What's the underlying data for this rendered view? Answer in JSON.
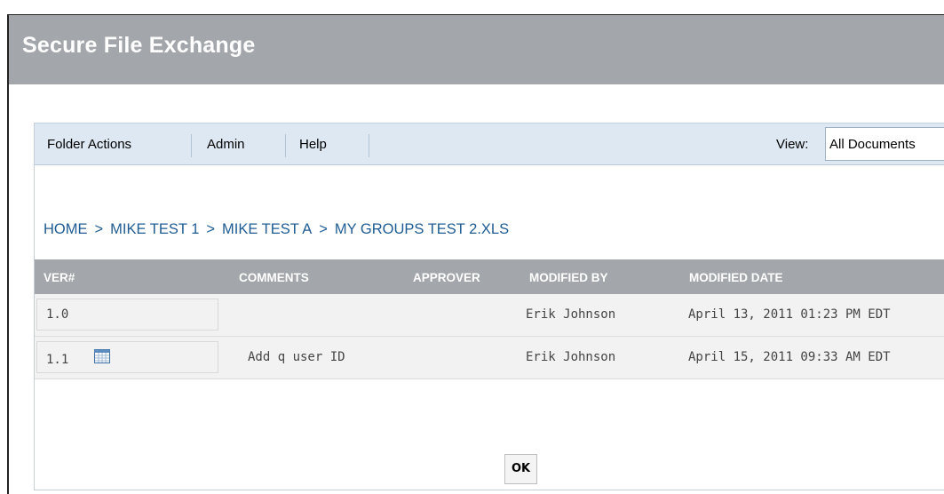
{
  "app": {
    "title": "Secure File Exchange"
  },
  "toolbar": {
    "menu": [
      "Folder Actions",
      "Admin",
      "Help"
    ],
    "view_label": "View:",
    "view_value": "All Documents"
  },
  "breadcrumb": [
    "HOME",
    "MIKE TEST 1",
    "MIKE TEST A",
    "MY GROUPS TEST 2.XLS"
  ],
  "breadcrumb_separator": ">",
  "table": {
    "columns": [
      "VER#",
      "COMMENTS",
      "APPROVER",
      "MODIFIED BY",
      "MODIFIED DATE"
    ],
    "rows": [
      {
        "ver": "1.0",
        "has_icon": false,
        "comments": "",
        "approver": "",
        "modified_by": "Erik Johnson",
        "modified_date": "April 13, 2011 01:23 PM EDT"
      },
      {
        "ver": "1.1",
        "has_icon": true,
        "icon": "calendar-icon",
        "comments": "Add q user ID",
        "approver": "",
        "modified_by": "Erik Johnson",
        "modified_date": "April 15, 2011 09:33 AM EDT"
      }
    ]
  },
  "ok_label": "OK",
  "colors": {
    "titlebar": "#a3a7ab",
    "toolbar": "#dde8f3",
    "breadcrumb": "#1f5c93",
    "table_header": "#a3a7ab",
    "row": "#f2f2f2"
  }
}
